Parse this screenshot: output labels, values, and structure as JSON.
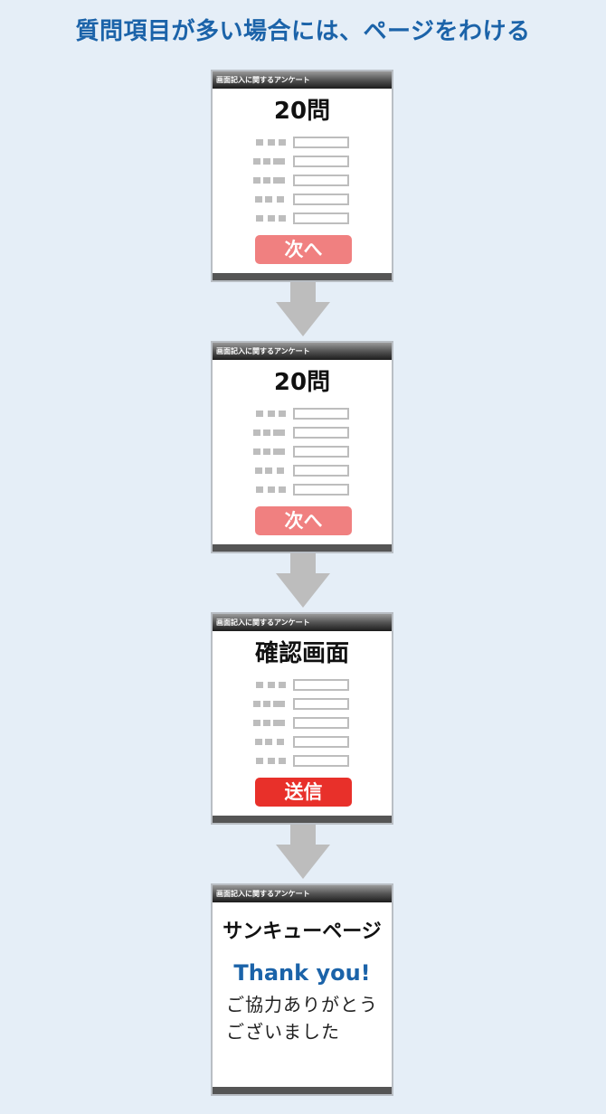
{
  "title": "質問項目が多い場合には、ページをわける",
  "screen_header": "画面記入に関するアンケート",
  "screens": [
    {
      "heading": "20問",
      "button": "次へ",
      "button_color": "#f08080"
    },
    {
      "heading": "20問",
      "button": "次へ",
      "button_color": "#f08080"
    },
    {
      "heading": "確認画面",
      "button": "送信",
      "button_color": "#e8302a"
    },
    {
      "heading": "サンキューページ",
      "thanks": "Thank you!",
      "message_line1": "ご協力ありがとう",
      "message_line2": "ございました"
    }
  ],
  "colors": {
    "background": "#e5eef7",
    "title": "#1b63a9",
    "arrow": "#bdbdbd",
    "placeholder": "#bdbdbd"
  },
  "icons": {
    "flow_arrow": "down-arrow-icon"
  }
}
